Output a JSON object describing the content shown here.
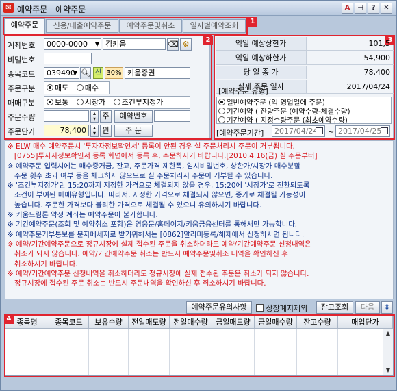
{
  "window": {
    "title": "예약주문 - 예약주문",
    "app_icon": "kiwoom-logo-icon"
  },
  "titlebar_buttons": [
    {
      "name": "font-icon",
      "glyph": "A"
    },
    {
      "name": "pin-icon",
      "glyph": "⊣"
    },
    {
      "name": "help-icon",
      "glyph": "?"
    },
    {
      "name": "close-icon",
      "glyph": "✕"
    }
  ],
  "markers": {
    "m1": "1",
    "m2": "2",
    "m3": "3",
    "m4": "4"
  },
  "tabs": [
    {
      "label": "예약주문",
      "active": true
    },
    {
      "label": "신용/대출예약주문",
      "active": false
    },
    {
      "label": "예약주문및취소",
      "active": false
    },
    {
      "label": "일자별예약조회",
      "active": false
    }
  ],
  "order_form": {
    "account_label": "계좌번호",
    "account_value": "0000-0000",
    "account_name": "김키움",
    "password_label": "비밀번호",
    "stock_label": "종목코드",
    "stock_code": "039490",
    "credit_badge": "신",
    "margin_rate": "30%",
    "stock_name": "키움증권",
    "order_type_label": "주문구분",
    "order_type_options": [
      "매도",
      "매수"
    ],
    "trade_type_label": "매매구분",
    "trade_type_options": [
      "보통",
      "시장가",
      "조건부지정가"
    ],
    "qty_label": "주문수량",
    "qty_unit": "주",
    "reservation_no_label": "예약번호",
    "price_label": "주문단가",
    "price_value": "78,400",
    "price_unit": "원",
    "order_button": "주 문"
  },
  "info_panel": {
    "rows": [
      {
        "label": "익일 예상상한가",
        "value": "101,5"
      },
      {
        "label": "익일 예상하한가",
        "value": "54,900"
      },
      {
        "label": "당 일 종 가",
        "value": "78,400"
      },
      {
        "label": "실제 주문 일자",
        "value": "2017/04/24"
      }
    ],
    "type_group_title": "[예약주문 유형]",
    "type_options": [
      "일반예약주문 (익 영업일에 주문)",
      "기간예약 ( 잔량주문 (예약수량-체결수량)",
      "기간예약 ( 지정수량주문 (최초예약수량)"
    ],
    "period_label": "[예약주문기간]",
    "period_from": "2017/04/24",
    "period_sep": "~",
    "period_to": "2017/04/25"
  },
  "notes": [
    {
      "color": "red",
      "text": "※ ELW 매수 예약주문시 '투자자정보확인서' 등록이 안된 경우 실 주문처리시 주문이 거부됩니다.\n   [0755]투자자정보확인서 등록 화면에서 등록 후, 주문하시기 바랍니다.[2010.4.16(금) 실 주문부터]"
    },
    {
      "color": "blue",
      "text": "※ 예약주문 입력시에는 매수증거금, 잔고, 주문가격 제한폭, 임시비밀번호, 상한가/시장가 매수분할\n   주문 횟수 초과 여부 등을 체크하지 않으므로 실 주문처리시 주문이 거부될 수 있습니다."
    },
    {
      "color": "blue",
      "text": "※ '조건부지정가'란 15:20까지 지정한 가격으로 체결되지 않을 경우, 15:20에 '시장가'로 전환되도록\n   조건이 부여된 매매유형입니다. 따라서, 지정한 가격으로 체결되지 않으면, 종가로 체결될 가능성이\n   높습니다. 주문한 가격보다 불리한 가격으로 체결될 수 있으니 유의하시기 바랍니다."
    },
    {
      "color": "blue",
      "text": "※ 키움드림론 약정 계좌는 예약주문이 불가합니다."
    },
    {
      "color": "blue",
      "text": "※ 기간예약주문(조회 및 예약취소 포함)은 영웅문/홈페이지/키움금융센터를 통해서만 가능합니다."
    },
    {
      "color": "blue",
      "text": "※ 예약주문거부통보를 문자메세지로 받기위해서는 [0862]알리미등록/해제에서 신청하시면 됩니다."
    },
    {
      "color": "red",
      "text": "※ 예약/기간예약주문으로 정규시장에 실제 접수된 주문을 취소하더라도 예약/기간예약주문 신청내역은\n   취소가 되지 않습니다. 예약/기간예약주문 취소는 반드시 예약주문및취소 내역을 확인하신 후\n   취소하시기 바랍니다."
    },
    {
      "color": "red",
      "text": "※ 예약/기간예약주문 신청내역을 취소하더라도 정규시장에 실제 접수된 주문은 취소가 되지 않습니다.\n   정규시장에 접수된 주문 취소는 반드시 주문내역을 확인하신 후 취소하시기 바랍니다."
    }
  ],
  "toolbar": {
    "notice_button": "예약주문유의사항",
    "delisted_checkbox": "상장폐지제외",
    "balance_button": "잔고조회",
    "next_button": "다음",
    "sort_icon": "sort-arrows-icon"
  },
  "grid": {
    "columns": [
      "종목명",
      "종목코드",
      "보유수량",
      "전일매도량",
      "전일매수량",
      "금일매도량",
      "금일매수량",
      "잔고수량",
      "매입단가"
    ]
  },
  "colors": {
    "accent": "#e0242f",
    "note_red": "#d8141b",
    "note_blue": "#10338a"
  }
}
